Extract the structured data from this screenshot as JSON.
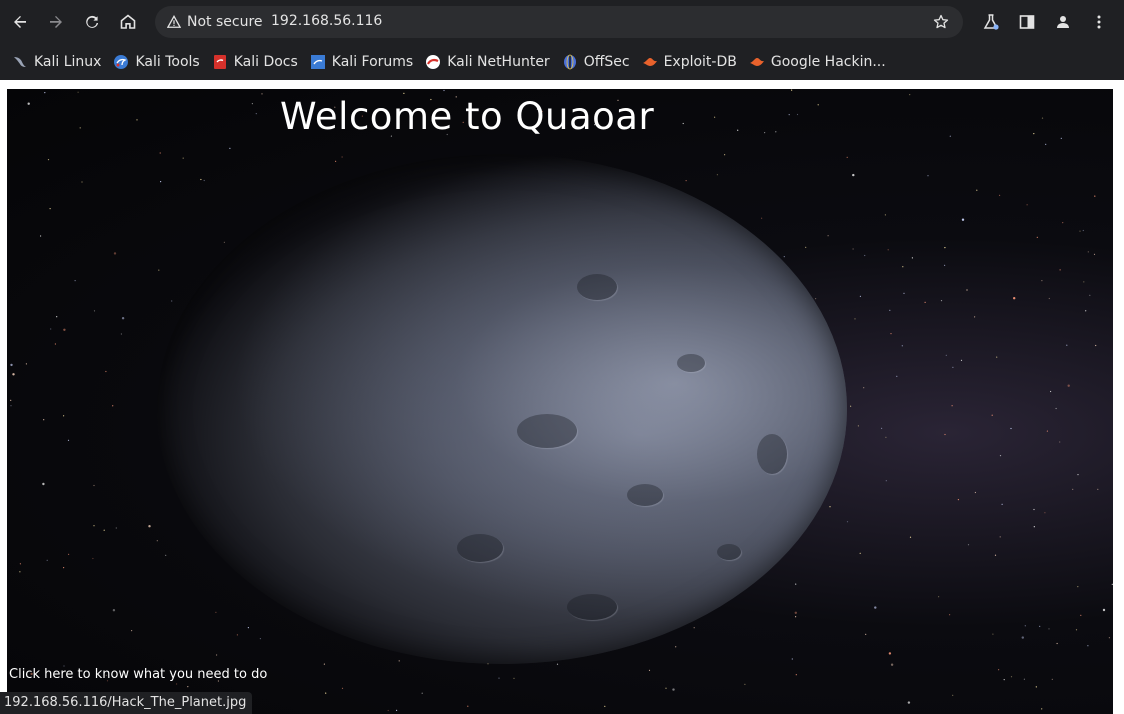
{
  "browser": {
    "security_label": "Not secure",
    "url": "192.168.56.116",
    "icons": {
      "back": "arrow-left-icon",
      "forward": "arrow-right-icon",
      "reload": "reload-icon",
      "home": "home-icon",
      "warning": "warning-triangle-icon",
      "bookmark_star": "star-icon",
      "labs": "flask-icon",
      "side_panel": "side-panel-icon",
      "profile": "person-icon",
      "menu": "kebab-menu-icon"
    }
  },
  "bookmarks": [
    {
      "label": "Kali Linux",
      "icon": "kali-dragon-icon",
      "color": "#9aa3b5"
    },
    {
      "label": "Kali Tools",
      "icon": "kali-tools-icon",
      "color": "#3a7bd5"
    },
    {
      "label": "Kali Docs",
      "icon": "kali-docs-icon",
      "color": "#d6312b"
    },
    {
      "label": "Kali Forums",
      "icon": "kali-forums-icon",
      "color": "#3a7bd5"
    },
    {
      "label": "Kali NetHunter",
      "icon": "nethunter-icon",
      "color": "#d6312b"
    },
    {
      "label": "OffSec",
      "icon": "offsec-icon",
      "color": "#4a6fd8"
    },
    {
      "label": "Exploit-DB",
      "icon": "exploit-db-icon",
      "color": "#e8622c"
    },
    {
      "label": "Google Hackin...",
      "icon": "ghdb-icon",
      "color": "#e8622c"
    }
  ],
  "page": {
    "title": "Welcome to Quaoar",
    "link_text": "Click here to know what you need to do"
  },
  "status_bar": {
    "hover_url": "192.168.56.116/Hack_The_Planet.jpg"
  }
}
